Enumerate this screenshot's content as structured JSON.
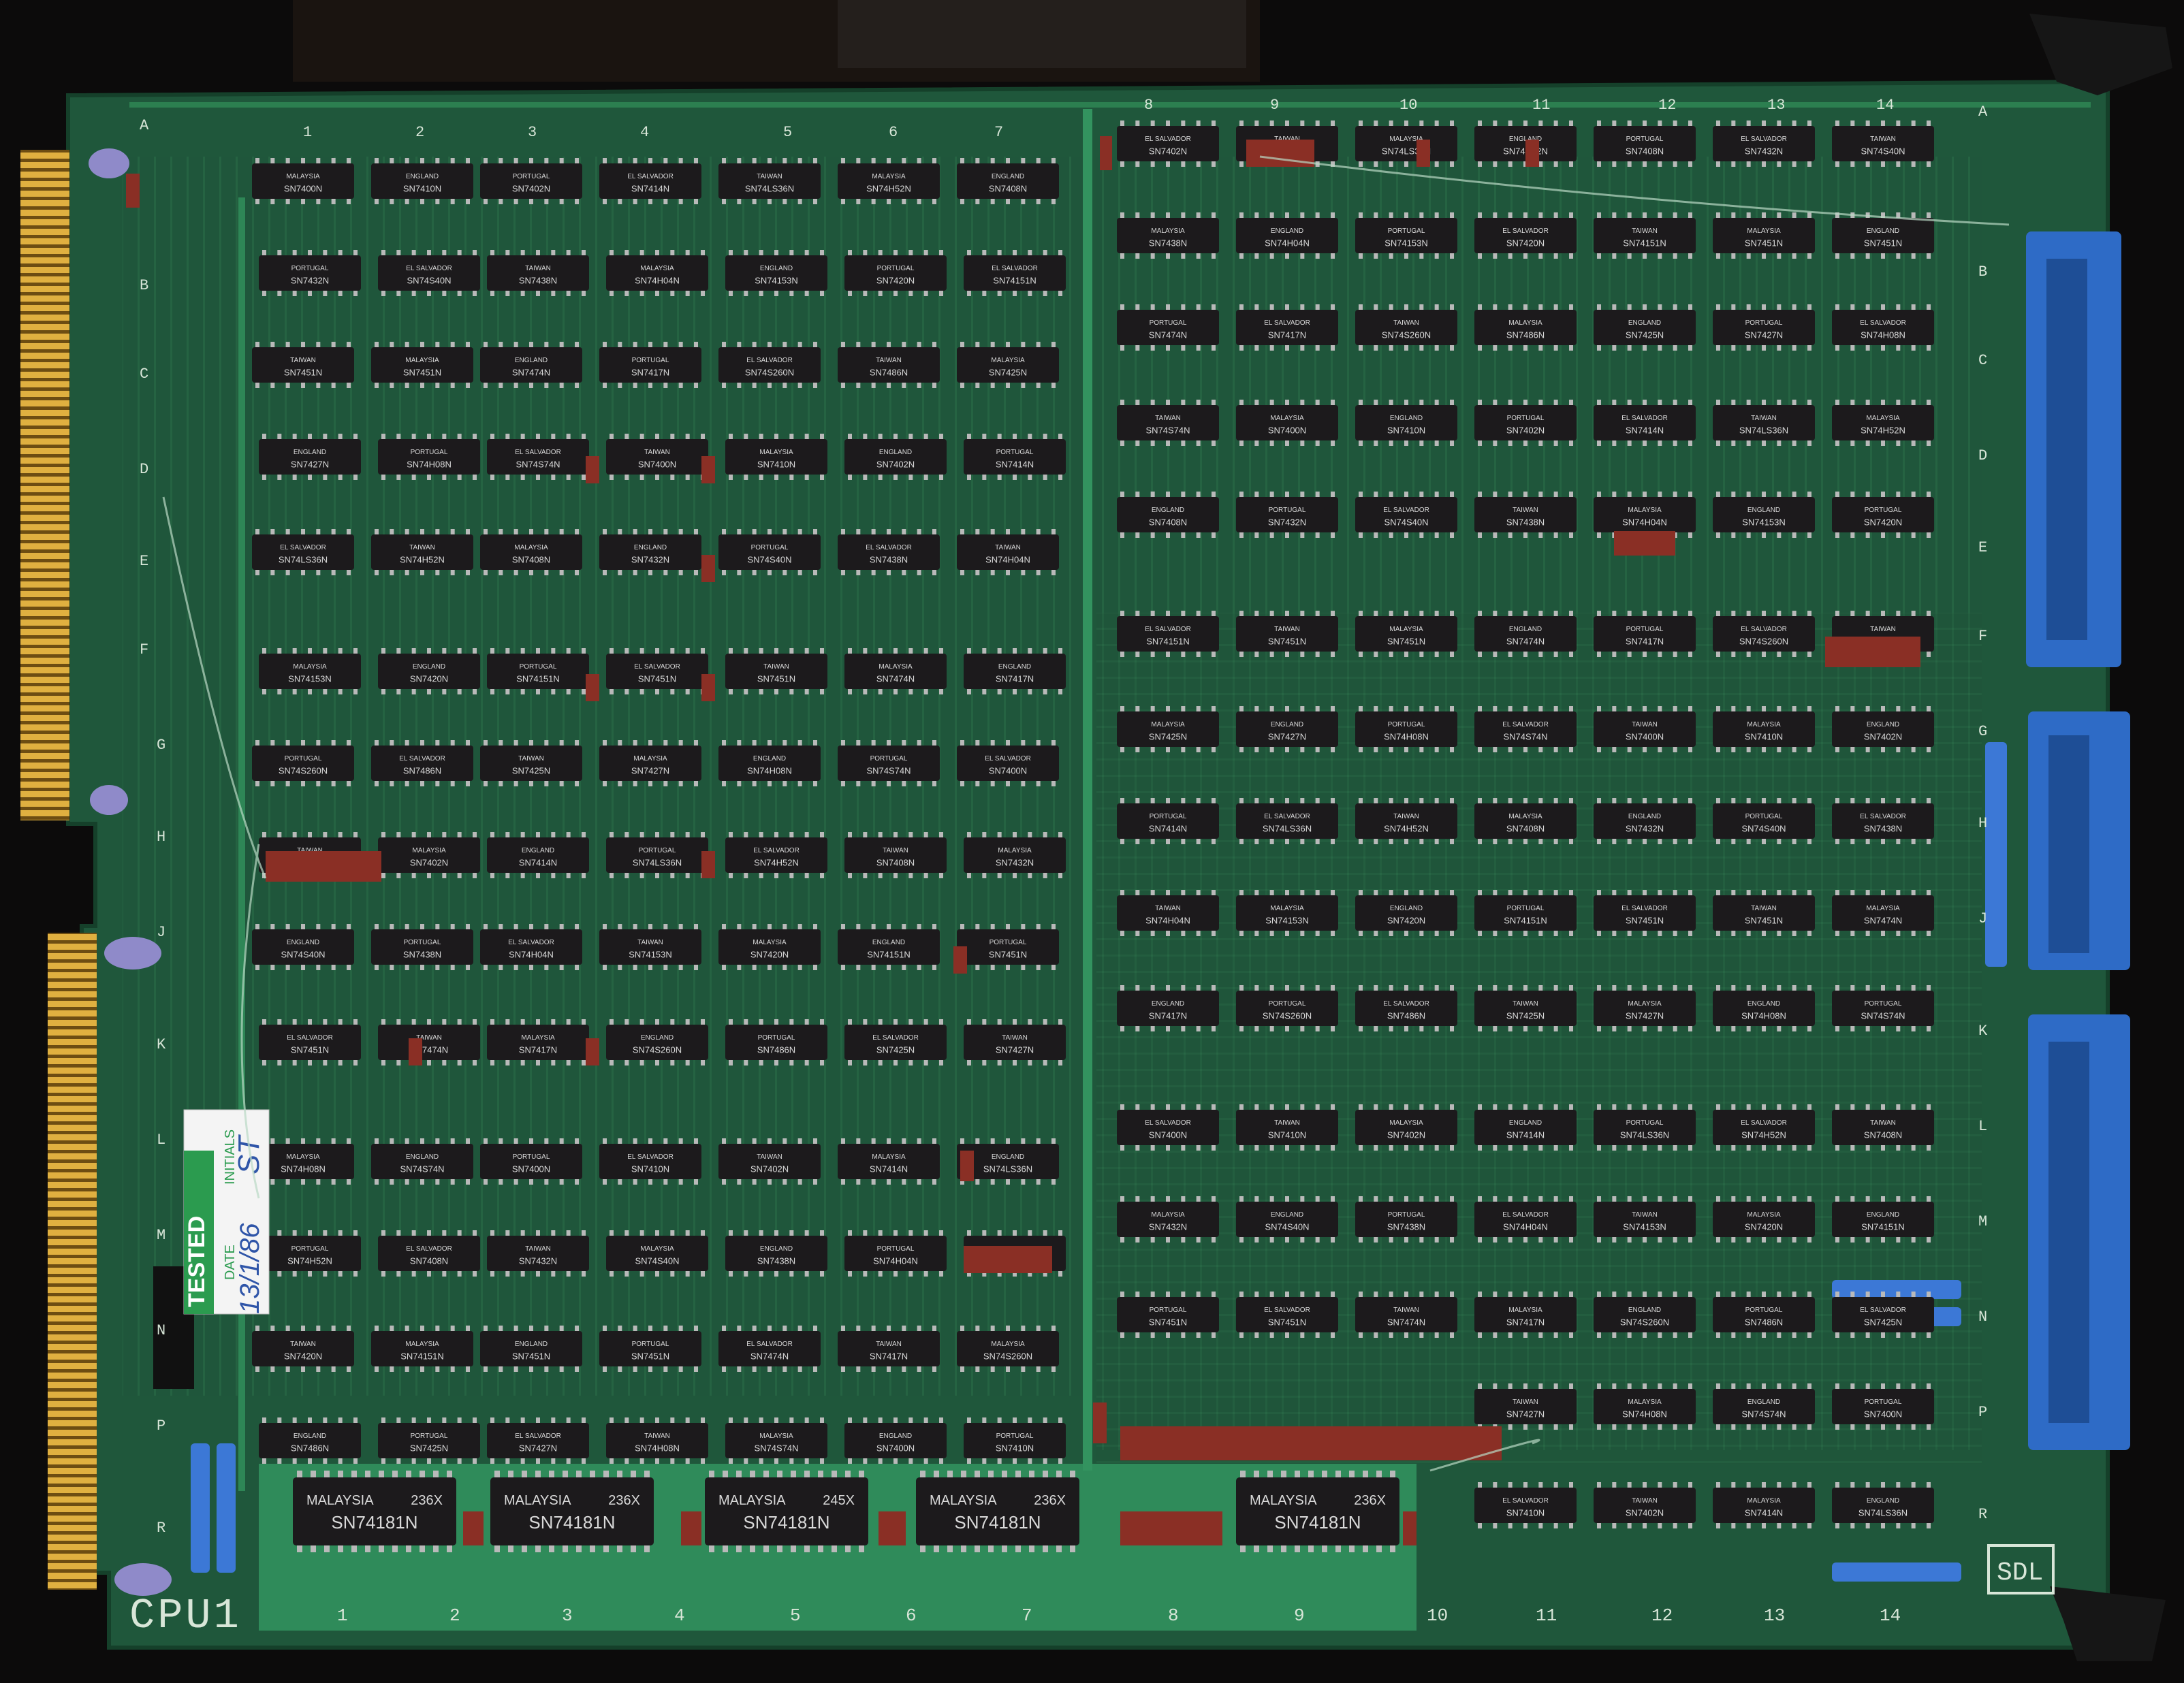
{
  "board": {
    "name": "CPU1",
    "maker_mark": "SDL",
    "column_numbers_bottom": [
      "1",
      "2",
      "3",
      "4",
      "5",
      "6",
      "7",
      "8",
      "9",
      "10",
      "11",
      "12",
      "13",
      "14"
    ],
    "column_numbers_top": [
      "1",
      "2",
      "3",
      "4",
      "5",
      "6",
      "7",
      "8",
      "9",
      "10",
      "11",
      "12",
      "13",
      "14"
    ],
    "row_letters": [
      "A",
      "B",
      "C",
      "D",
      "E",
      "F",
      "G",
      "H",
      "J",
      "K",
      "L",
      "M",
      "N",
      "P",
      "R"
    ]
  },
  "test_label": {
    "tested": "TESTED",
    "date_caption": "DATE",
    "initials_caption": "INITIALS",
    "date_value": "13/1/86",
    "initials_value": "ST"
  },
  "chip_markings": [
    "SN7400N",
    "SN7410N",
    "SN7402N",
    "SN7414N",
    "SN74LS36N",
    "SN74H52N",
    "SN7408N",
    "SN7432N",
    "SN74S40N",
    "SN7438N",
    "SN74H04N",
    "SN74153N",
    "SN7420N",
    "SN74151N",
    "SN7451N",
    "SN7451N",
    "SN7474N",
    "SN7417N",
    "SN74S260N",
    "SN7486N",
    "SN7425N",
    "SN7427N",
    "SN74H08N",
    "SN74S74N"
  ],
  "chip_origins": [
    "MALAYSIA",
    "ENGLAND",
    "PORTUGAL",
    "EL SALVADOR",
    "TAIWAN"
  ],
  "alu_chips": [
    {
      "origin": "MALAYSIA",
      "code": "236X",
      "part": "SN74181N"
    },
    {
      "origin": "MALAYSIA",
      "code": "236X",
      "part": "SN74181N"
    },
    {
      "origin": "MALAYSIA",
      "code": "245X",
      "part": "SN74181N"
    },
    {
      "origin": "MALAYSIA",
      "code": "236X",
      "part": "SN74181N"
    },
    {
      "origin": "MALAYSIA",
      "code": "236X",
      "part": "SN74181N"
    }
  ],
  "colors": {
    "pcb": "#1f5a3d",
    "pcb_light": "#2e8a5a",
    "trace": "#3fa06a",
    "gold": "#d8a93a",
    "chip": "#1c1a1c",
    "chip_pin": "#b9b9b9",
    "resistor_pack": "#8a2f25",
    "connector": "#2d68c4",
    "silkscreen": "#e6efe6"
  }
}
